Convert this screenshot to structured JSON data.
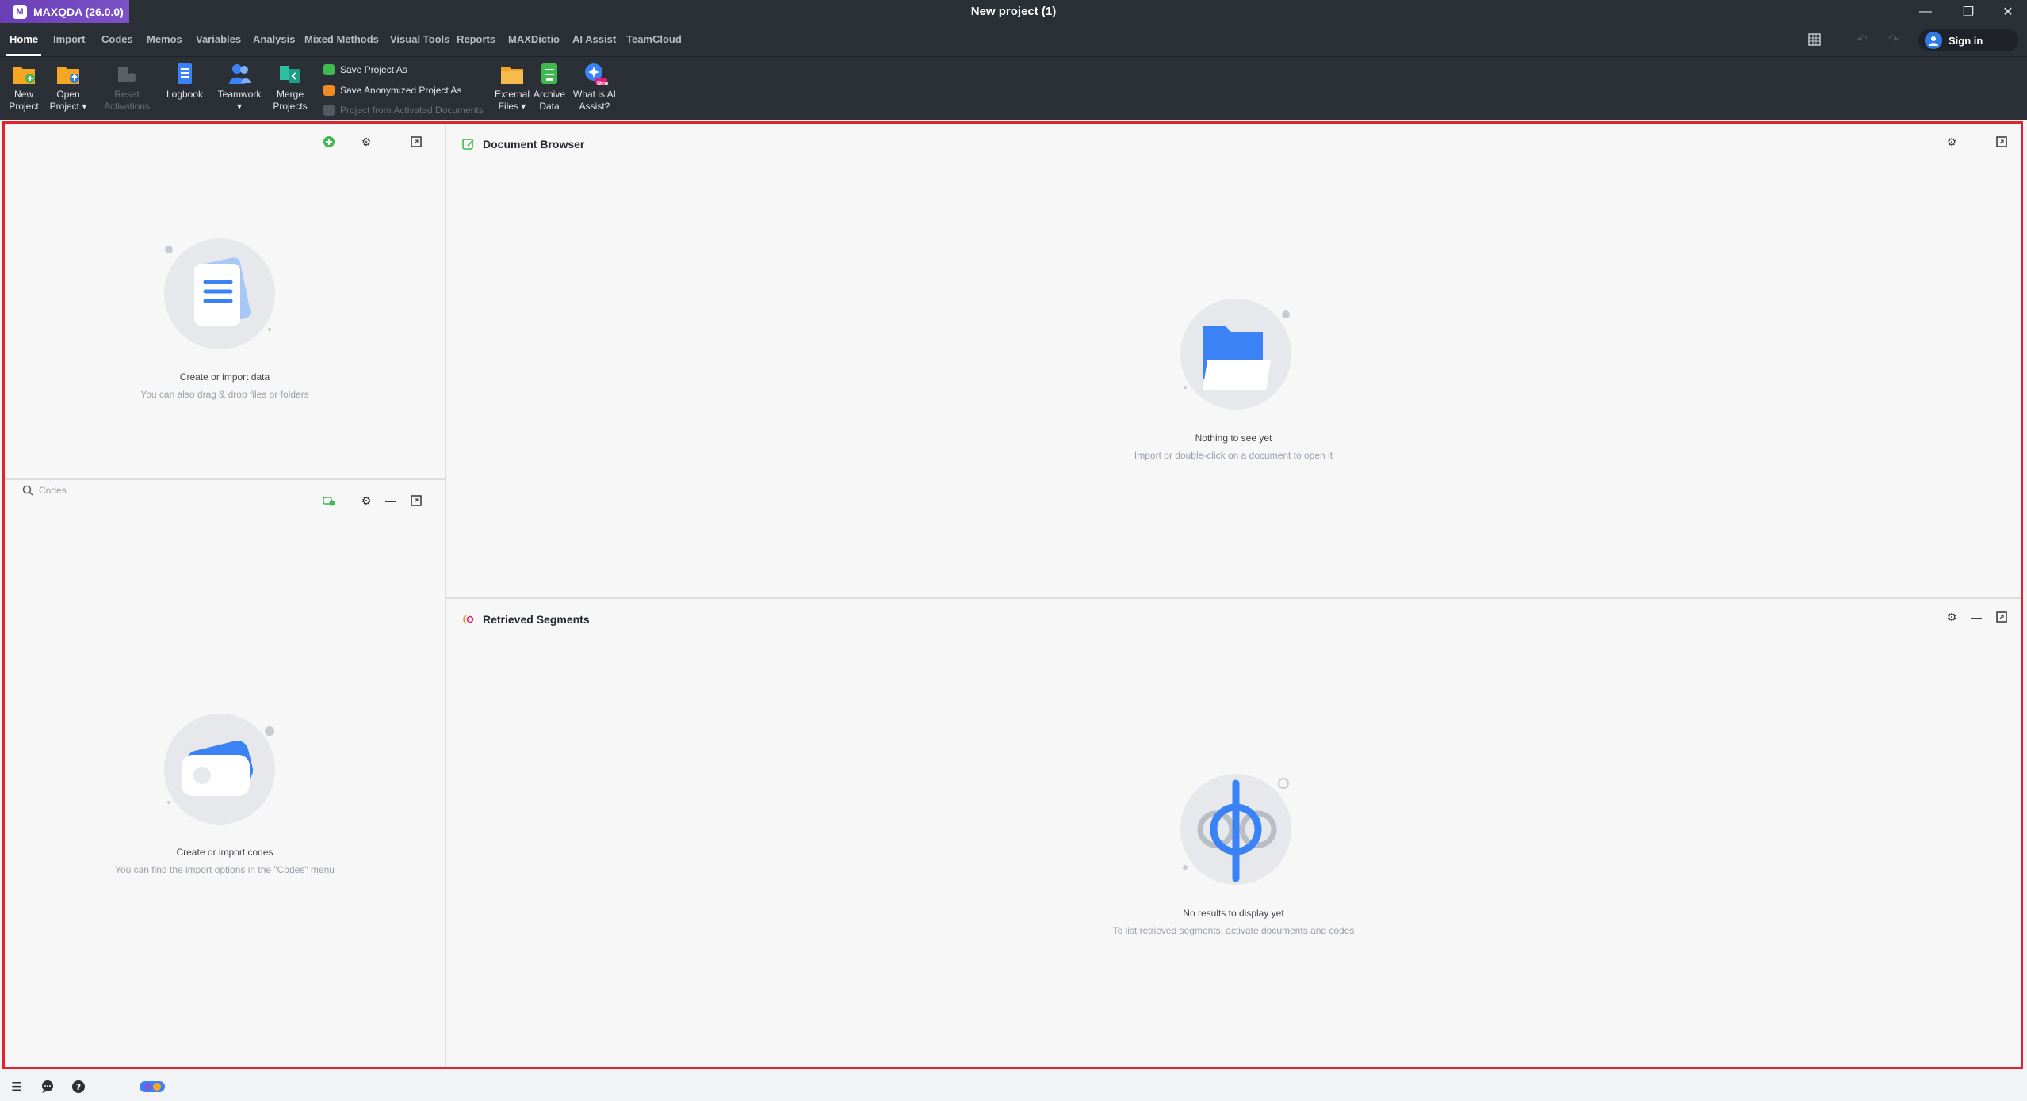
{
  "app": {
    "name": "MAXQDA (26.0.0)",
    "window_title": "New project (1)"
  },
  "menu": {
    "tabs": [
      "Home",
      "Import",
      "Codes",
      "Memos",
      "Variables",
      "Analysis",
      "Mixed Methods",
      "Visual Tools",
      "Reports",
      "MAXDictio",
      "AI Assist",
      "TeamCloud"
    ],
    "active": "Home",
    "sign_in": "Sign in"
  },
  "ribbon": {
    "new_project": [
      "New",
      "Project"
    ],
    "open_project": [
      "Open",
      "Project ▾"
    ],
    "reset_activations": [
      "Reset",
      "Activations"
    ],
    "logbook": "Logbook",
    "teamwork": [
      "Teamwork",
      "▾"
    ],
    "merge_projects": [
      "Merge",
      "Projects"
    ],
    "save_project_as": "Save Project As",
    "save_anonymized": "Save Anonymized Project As",
    "project_from_activated": "Project from Activated Documents",
    "external_files": [
      "External",
      "Files ▾"
    ],
    "archive_data": [
      "Archive",
      "Data"
    ],
    "what_is_ai_assist": [
      "What is AI",
      "Assist?"
    ],
    "new_badge": "New"
  },
  "document_system": {
    "empty_title": "Create or import data",
    "empty_sub": "You can also drag & drop files or folders"
  },
  "code_system": {
    "search_placeholder": "Codes",
    "empty_title": "Create or import codes",
    "empty_sub": "You can find the import options in the \"Codes\" menu"
  },
  "document_browser": {
    "title": "Document Browser",
    "empty_title": "Nothing to see yet",
    "empty_sub": "Import or double-click on a document to open it"
  },
  "retrieved_segments": {
    "title": "Retrieved Segments",
    "empty_title": "No results to display yet",
    "empty_sub": "To list retrieved segments, activate documents and codes"
  },
  "colors": {
    "accent": "#2f7be5",
    "highlight_border": "#e0242b",
    "title_bar": "#2b2f36",
    "brand": "#6a3fb5"
  }
}
